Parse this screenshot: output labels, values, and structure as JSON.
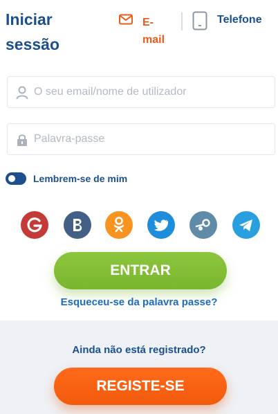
{
  "header": {
    "title": "Iniciar sessão",
    "tabs": [
      {
        "label": "E-mail",
        "icon": "envelope-icon",
        "active": true,
        "color": "#ea5a1a"
      },
      {
        "label": "Telefone",
        "icon": "phone-icon",
        "active": false,
        "color": "#1b4f8e"
      }
    ]
  },
  "form": {
    "username_placeholder": "O seu email/nome de utilizador",
    "username_value": "",
    "password_placeholder": "Palavra-passe",
    "password_value": "",
    "remember_label": "Lembrem-se de mim",
    "remember_checked": true
  },
  "social": [
    {
      "name": "google",
      "icon": "google-icon",
      "color": "#c43a36"
    },
    {
      "name": "vk",
      "icon": "vk-icon",
      "color": "#445f86"
    },
    {
      "name": "odnoklassniki",
      "icon": "odnoklassniki-icon",
      "color": "#f7931e"
    },
    {
      "name": "twitter",
      "icon": "twitter-icon",
      "color": "#1e8ddc"
    },
    {
      "name": "steam",
      "icon": "steam-icon",
      "color": "#5f8aa8"
    },
    {
      "name": "telegram",
      "icon": "telegram-icon",
      "color": "#2a9fe0"
    }
  ],
  "actions": {
    "login_label": "ENTRAR",
    "forgot_label": "Esqueceu-se da palavra passe?",
    "register_question": "Ainda não está registrado?",
    "register_label": "REGISTE-SE"
  },
  "colors": {
    "primary": "#1b4f8e",
    "accent": "#ea5a1a",
    "login_button": "#7ab52e",
    "register_button": "#f25a0c",
    "link": "#1e6cc0"
  }
}
